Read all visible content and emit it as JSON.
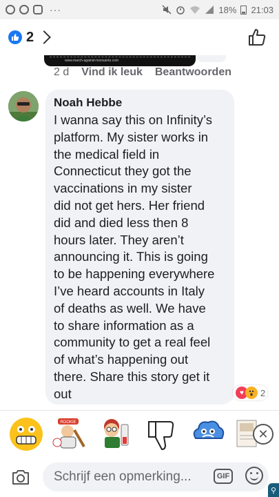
{
  "status_bar": {
    "dots": "···",
    "battery": "18%",
    "time": "21:03",
    "icons": [
      "whatsapp-icon",
      "messenger-icon",
      "instagram-icon",
      "mute-icon",
      "alarm-icon",
      "wifi-icon",
      "signal-icon",
      "battery-icon"
    ]
  },
  "header": {
    "like_count": "2",
    "icons": [
      "like-badge-icon",
      "chevron-right-icon",
      "thumbs-up-outline-icon"
    ]
  },
  "previous_comment": {
    "image_caption": "www.march-against-monsanto.com",
    "time": "2 d",
    "like_label": "Vind ik leuk",
    "reply_label": "Beantwoorden"
  },
  "comment": {
    "author": "Noah Hebbe",
    "lines": [
      "I wanna say this on Infinity’s",
      "platform. My sister works in",
      "the medical field in",
      "Connecticut they got the",
      "vaccinations in my sister",
      "did not get hers. Her friend",
      "did and died less then 8",
      "hours later. They aren’t",
      "announcing it. This is going",
      "to be happening everywhere",
      "I’ve heard accounts in Italy",
      "of deaths as well. We have",
      "to share information as a",
      "community to get a real feel",
      "of what’s happening out",
      "there. Share this story get it",
      "out"
    ],
    "reaction_count": "2",
    "reaction_icons": [
      "heart-reaction-icon",
      "wow-reaction-icon"
    ]
  },
  "sticker_tray": {
    "stickers": [
      {
        "name": "grimace-emoji-sticker"
      },
      {
        "name": "baseball-character-sticker",
        "badge": "ROOKIE"
      },
      {
        "name": "cartoon-kid-sticker"
      },
      {
        "name": "thumbs-down-sticker"
      },
      {
        "name": "blue-cloud-sticker"
      },
      {
        "name": "document-sticker"
      }
    ]
  },
  "composer": {
    "placeholder": "Schrijf een opmerking...",
    "gif_label": "GIF",
    "icons": [
      "camera-icon",
      "gif-icon",
      "emoji-icon"
    ]
  },
  "colors": {
    "facebook_blue": "#1877f2",
    "bubble_bg": "#f0f2f5",
    "secondary_text": "#65676b",
    "heart": "#f33e58",
    "wow": "#f7b125"
  }
}
